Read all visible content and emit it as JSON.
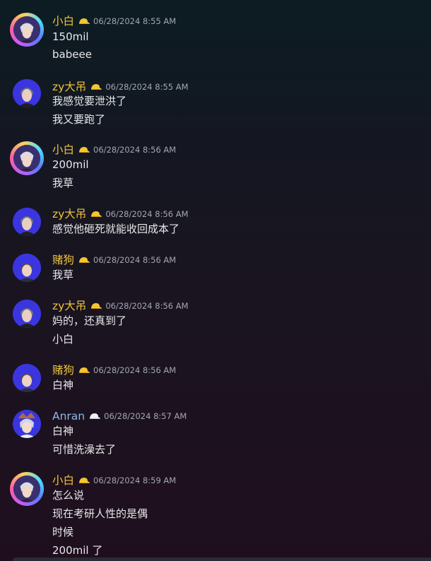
{
  "colors": {
    "name_gold": "#f0c53a",
    "name_blue": "#8fb6e8",
    "timestamp": "#a3a6b2",
    "message_text": "#e7e8ea"
  },
  "messages": [
    {
      "author": "小白",
      "timestamp": "06/28/2024 8:55 AM",
      "lines": [
        "150mil",
        "babeee"
      ]
    },
    {
      "author": "zy大吊",
      "timestamp": "06/28/2024 8:55 AM",
      "lines": [
        "我感觉要泄洪了",
        "我又要跑了"
      ]
    },
    {
      "author": "小白",
      "timestamp": "06/28/2024 8:56 AM",
      "lines": [
        "200mil",
        "我草"
      ]
    },
    {
      "author": "zy大吊",
      "timestamp": "06/28/2024 8:56 AM",
      "lines": [
        "感觉他砸死就能收回成本了"
      ]
    },
    {
      "author": "赌狗",
      "timestamp": "06/28/2024 8:56 AM",
      "lines": [
        "我草"
      ]
    },
    {
      "author": "zy大吊",
      "timestamp": "06/28/2024 8:56 AM",
      "lines": [
        "妈的，还真到了",
        "小白"
      ]
    },
    {
      "author": "赌狗",
      "timestamp": "06/28/2024 8:56 AM",
      "lines": [
        "白神"
      ]
    },
    {
      "author": "Anran",
      "timestamp": "06/28/2024 8:57 AM",
      "lines": [
        "白神",
        "可惜洗澡去了"
      ]
    },
    {
      "author": "小白",
      "timestamp": "06/28/2024 8:59 AM",
      "lines": [
        "怎么说",
        "现在考研人性的是偶",
        "时候",
        "200mil 了"
      ]
    }
  ]
}
